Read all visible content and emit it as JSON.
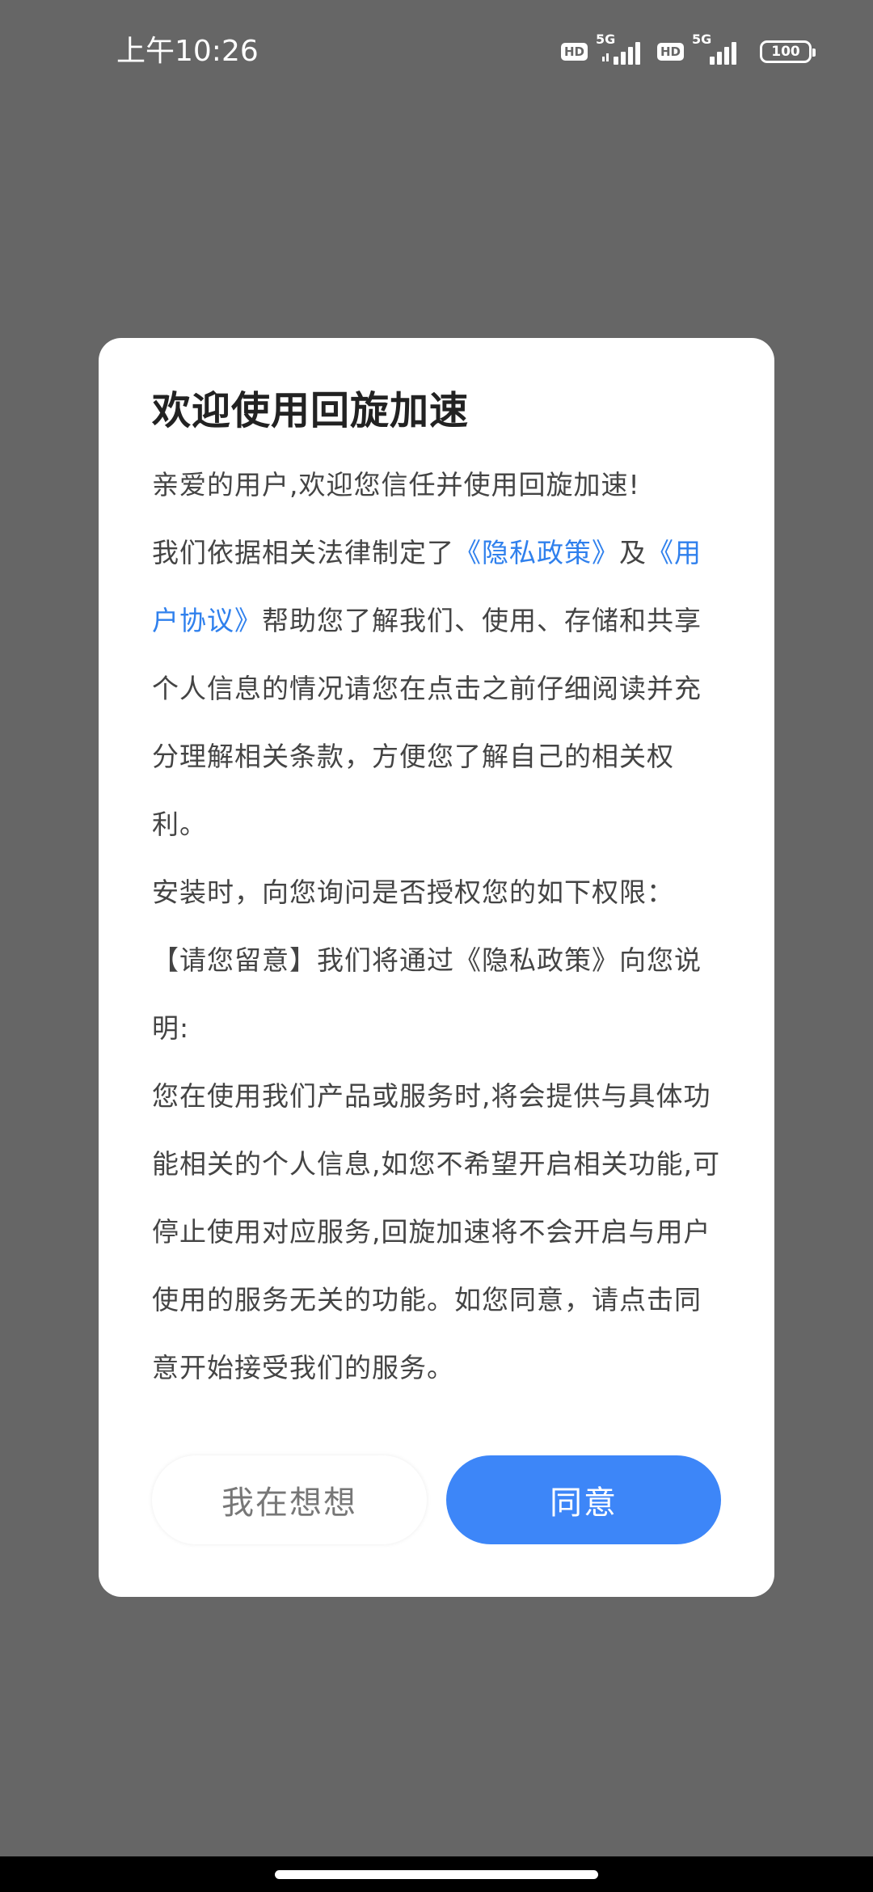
{
  "status_bar": {
    "time": "上午10:26",
    "hd1": "HD",
    "net1": "5G",
    "hd2": "HD",
    "net2": "5G",
    "battery": "100"
  },
  "dialog": {
    "title": "欢迎使用回旋加速",
    "greeting": "亲爱的用户,欢迎您信任并使用回旋加速!",
    "para1_prefix": "我们依据相关法律制定了",
    "privacy_link": "《隐私政策》",
    "para1_and": "及",
    "agreement_link": "《用户协议》",
    "para1_suffix": "帮助您了解我们、使用、存储和共享个人信息的情况请您在点击之前仔细阅读并充分理解相关条款，方便您了解自己的相关权利。",
    "para2": "安装时，向您询问是否授权您的如下权限：",
    "para3": "【请您留意】我们将通过《隐私政策》向您说明:",
    "para4": "您在使用我们产品或服务时,将会提供与具体功能相关的个人信息,如您不希望开启相关功能,可停止使用对应服务,回旋加速将不会开启与用户使用的服务无关的功能。如您同意，请点击同意开始接受我们的服务。",
    "decline_button": "我在想想",
    "agree_button": "同意"
  },
  "colors": {
    "overlay": "#666666",
    "link": "#2f80ed",
    "primary": "#3d86f8"
  }
}
